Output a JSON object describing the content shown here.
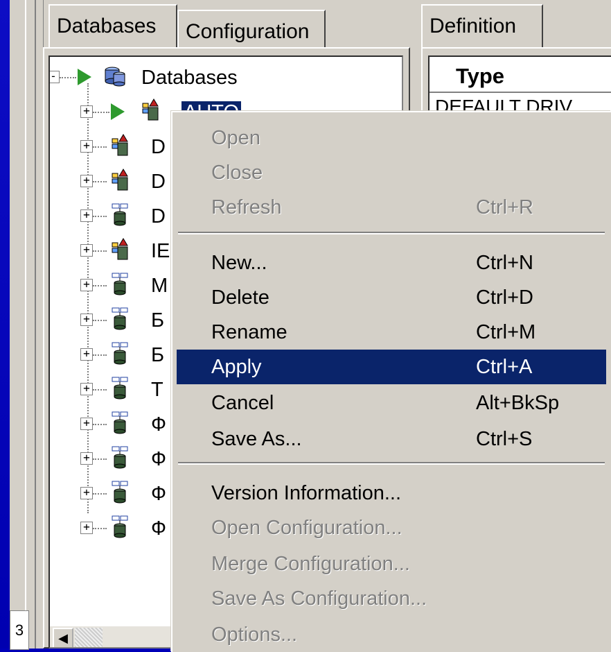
{
  "tabs": {
    "databases": "Databases",
    "configuration": "Configuration",
    "definition": "Definition"
  },
  "tree": {
    "root_label": "Databases",
    "selected_label": "AUTO",
    "rows": [
      "D",
      "D",
      "D",
      "IE",
      "M",
      "Б",
      "Б",
      "Т",
      "Ф",
      "Ф",
      "Ф",
      "Ф"
    ],
    "row_icons": [
      "red-db-icon",
      "red-db-icon",
      "blue-db-icon",
      "red-db-icon",
      "blue-db-icon",
      "blue-db-icon",
      "blue-db-icon",
      "blue-db-icon",
      "blue-db-icon",
      "blue-db-icon",
      "blue-db-icon",
      "blue-db-icon"
    ]
  },
  "details": {
    "column_header": "Type",
    "first_value": "DEFAULT DRIV"
  },
  "left_strip": {
    "mini_label": "3"
  },
  "menu": {
    "items": [
      {
        "label": "Open",
        "shortcut": "",
        "disabled": true
      },
      {
        "label": "Close",
        "shortcut": "",
        "disabled": true
      },
      {
        "label": "Refresh",
        "shortcut": "Ctrl+R",
        "disabled": true
      },
      {
        "label": "New...",
        "shortcut": "Ctrl+N",
        "disabled": false
      },
      {
        "label": "Delete",
        "shortcut": "Ctrl+D",
        "disabled": false
      },
      {
        "label": "Rename",
        "shortcut": "Ctrl+M",
        "disabled": false
      },
      {
        "label": "Apply",
        "shortcut": "Ctrl+A",
        "disabled": false,
        "highlighted": true
      },
      {
        "label": "Cancel",
        "shortcut": "Alt+BkSp",
        "disabled": false
      },
      {
        "label": "Save As...",
        "shortcut": "Ctrl+S",
        "disabled": false
      },
      {
        "label": "Version Information...",
        "shortcut": "",
        "disabled": false
      },
      {
        "label": "Open Configuration...",
        "shortcut": "",
        "disabled": true
      },
      {
        "label": "Merge Configuration...",
        "shortcut": "",
        "disabled": true
      },
      {
        "label": "Save As Configuration...",
        "shortcut": "",
        "disabled": true
      },
      {
        "label": "Options...",
        "shortcut": "",
        "disabled": true
      }
    ]
  },
  "colors": {
    "background_blue": "#0000b8",
    "window_gray": "#d4d0c8",
    "highlight_navy": "#0a246a",
    "play_green": "#2e9a2e"
  }
}
